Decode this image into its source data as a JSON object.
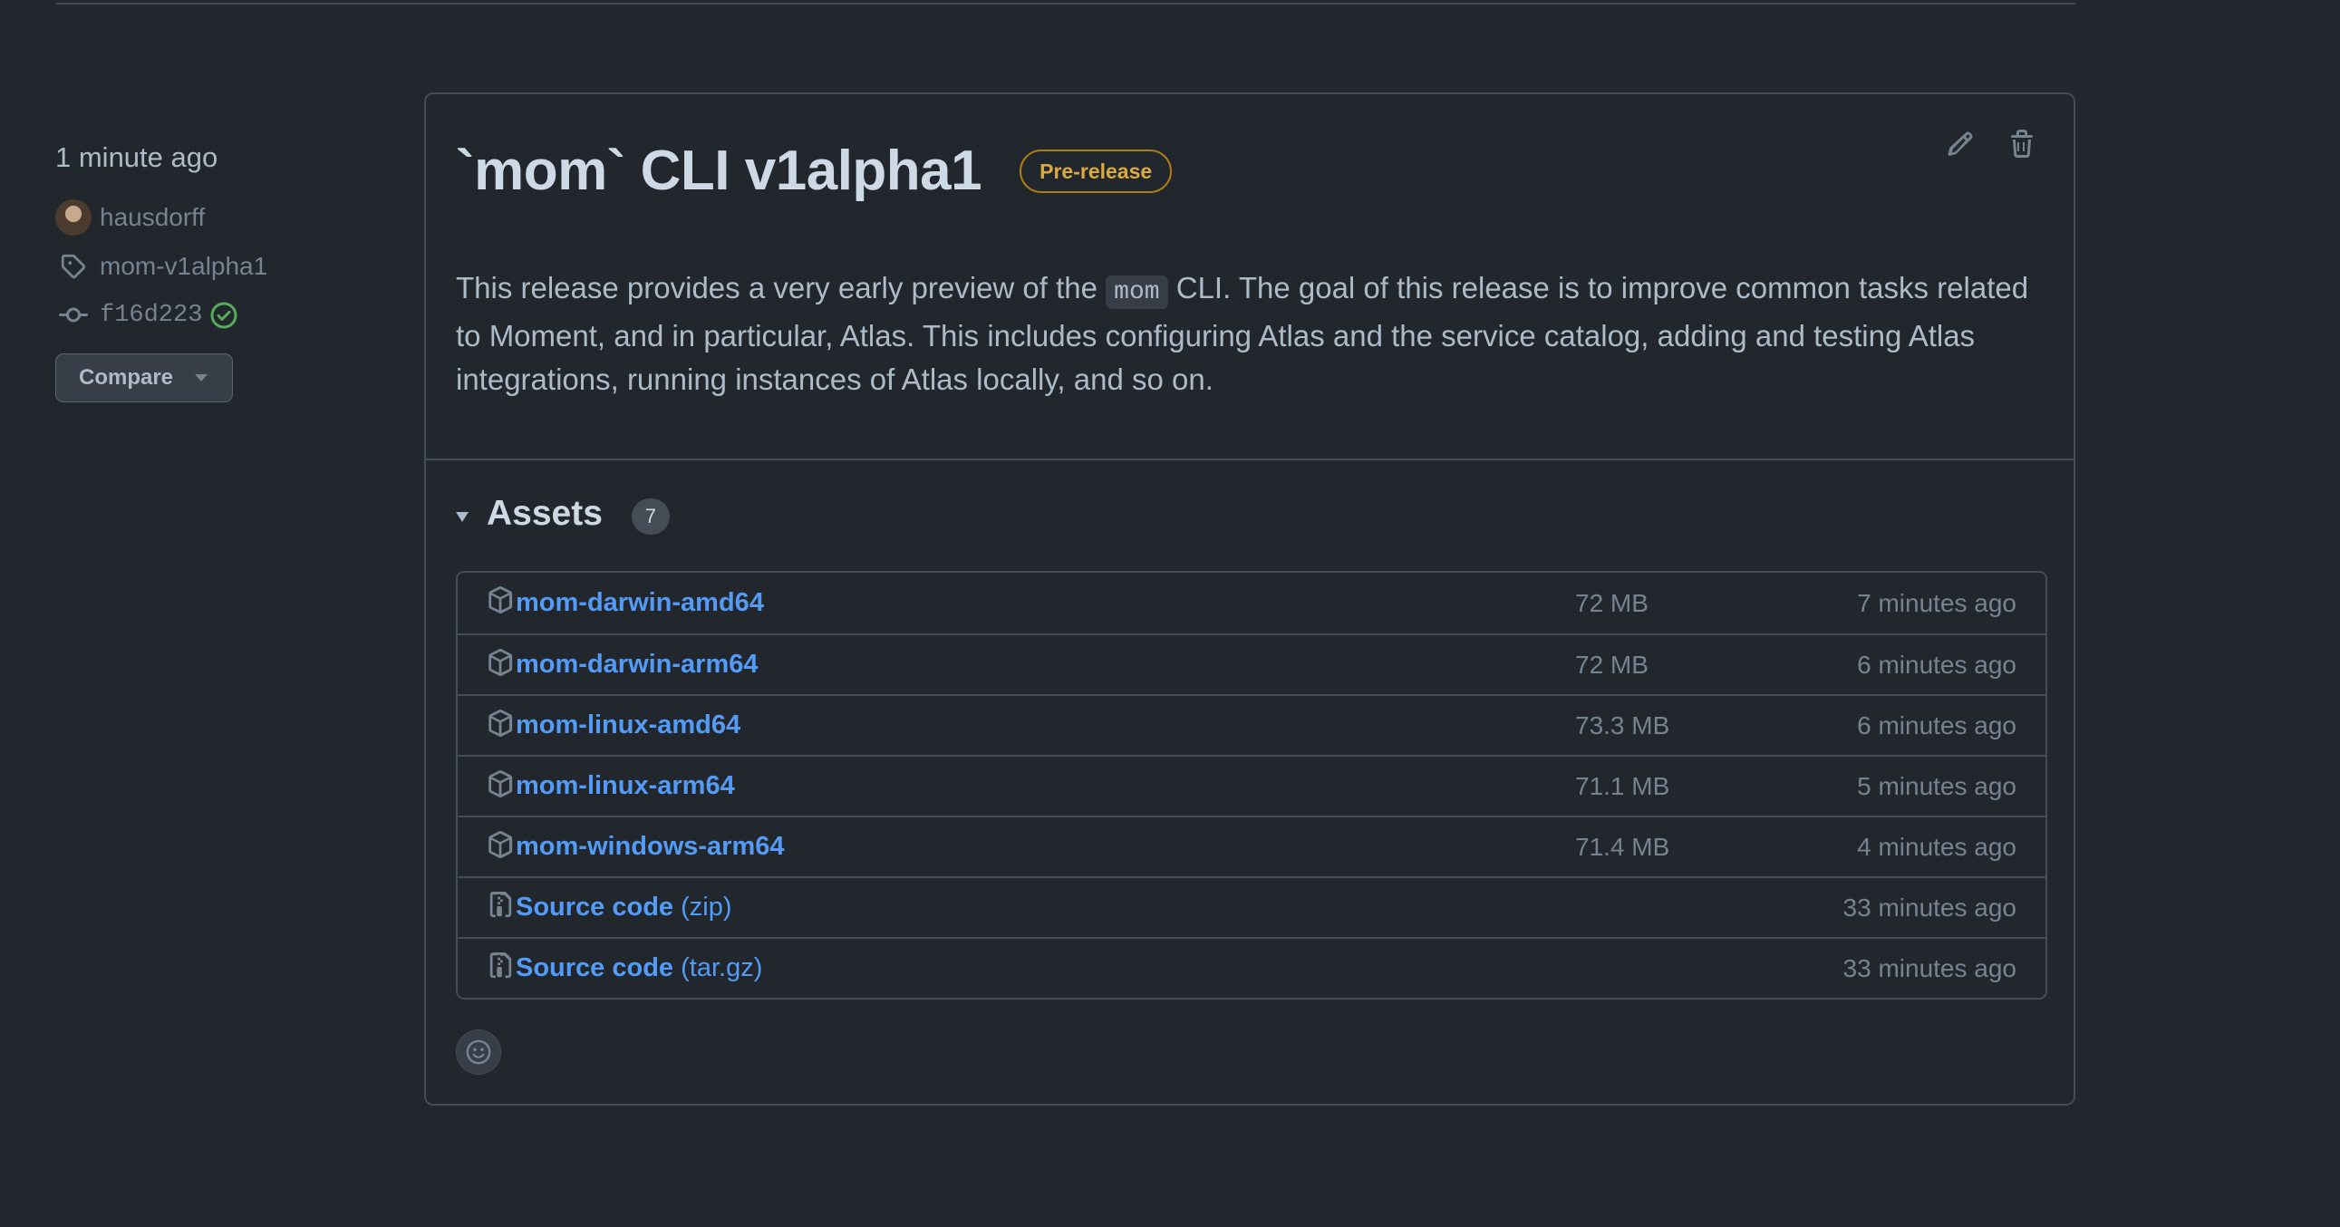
{
  "meta": {
    "published": "1 minute ago",
    "author": "hausdorff",
    "tag": "mom-v1alpha1",
    "commit": "f16d223",
    "compare_label": "Compare"
  },
  "release": {
    "title": "`mom` CLI v1alpha1",
    "badge": "Pre-release",
    "body_before": "This release provides a very early preview of the ",
    "body_code": "mom",
    "body_after": " CLI. The goal of this release is to improve common tasks related to Moment, and in particular, Atlas. This includes configuring Atlas and the service catalog, adding and testing Atlas integrations, running instances of Atlas locally, and so on."
  },
  "assets": {
    "heading": "Assets",
    "count": "7",
    "items": [
      {
        "name": "mom-darwin-amd64",
        "suffix": "",
        "size": "72 MB",
        "time": "7 minutes ago",
        "icon": "package-icon"
      },
      {
        "name": "mom-darwin-arm64",
        "suffix": "",
        "size": "72 MB",
        "time": "6 minutes ago",
        "icon": "package-icon"
      },
      {
        "name": "mom-linux-amd64",
        "suffix": "",
        "size": "73.3 MB",
        "time": "6 minutes ago",
        "icon": "package-icon"
      },
      {
        "name": "mom-linux-arm64",
        "suffix": "",
        "size": "71.1 MB",
        "time": "5 minutes ago",
        "icon": "package-icon"
      },
      {
        "name": "mom-windows-arm64",
        "suffix": "",
        "size": "71.4 MB",
        "time": "4 minutes ago",
        "icon": "package-icon"
      },
      {
        "name": "Source code",
        "suffix": " (zip)",
        "size": "",
        "time": "33 minutes ago",
        "icon": "file-zip-icon"
      },
      {
        "name": "Source code",
        "suffix": " (tar.gz)",
        "size": "",
        "time": "33 minutes ago",
        "icon": "file-zip-icon"
      }
    ]
  },
  "colors": {
    "background": "#22272e",
    "link": "#539bf5",
    "badge": "#daaa3f",
    "verified": "#57ab5a"
  }
}
